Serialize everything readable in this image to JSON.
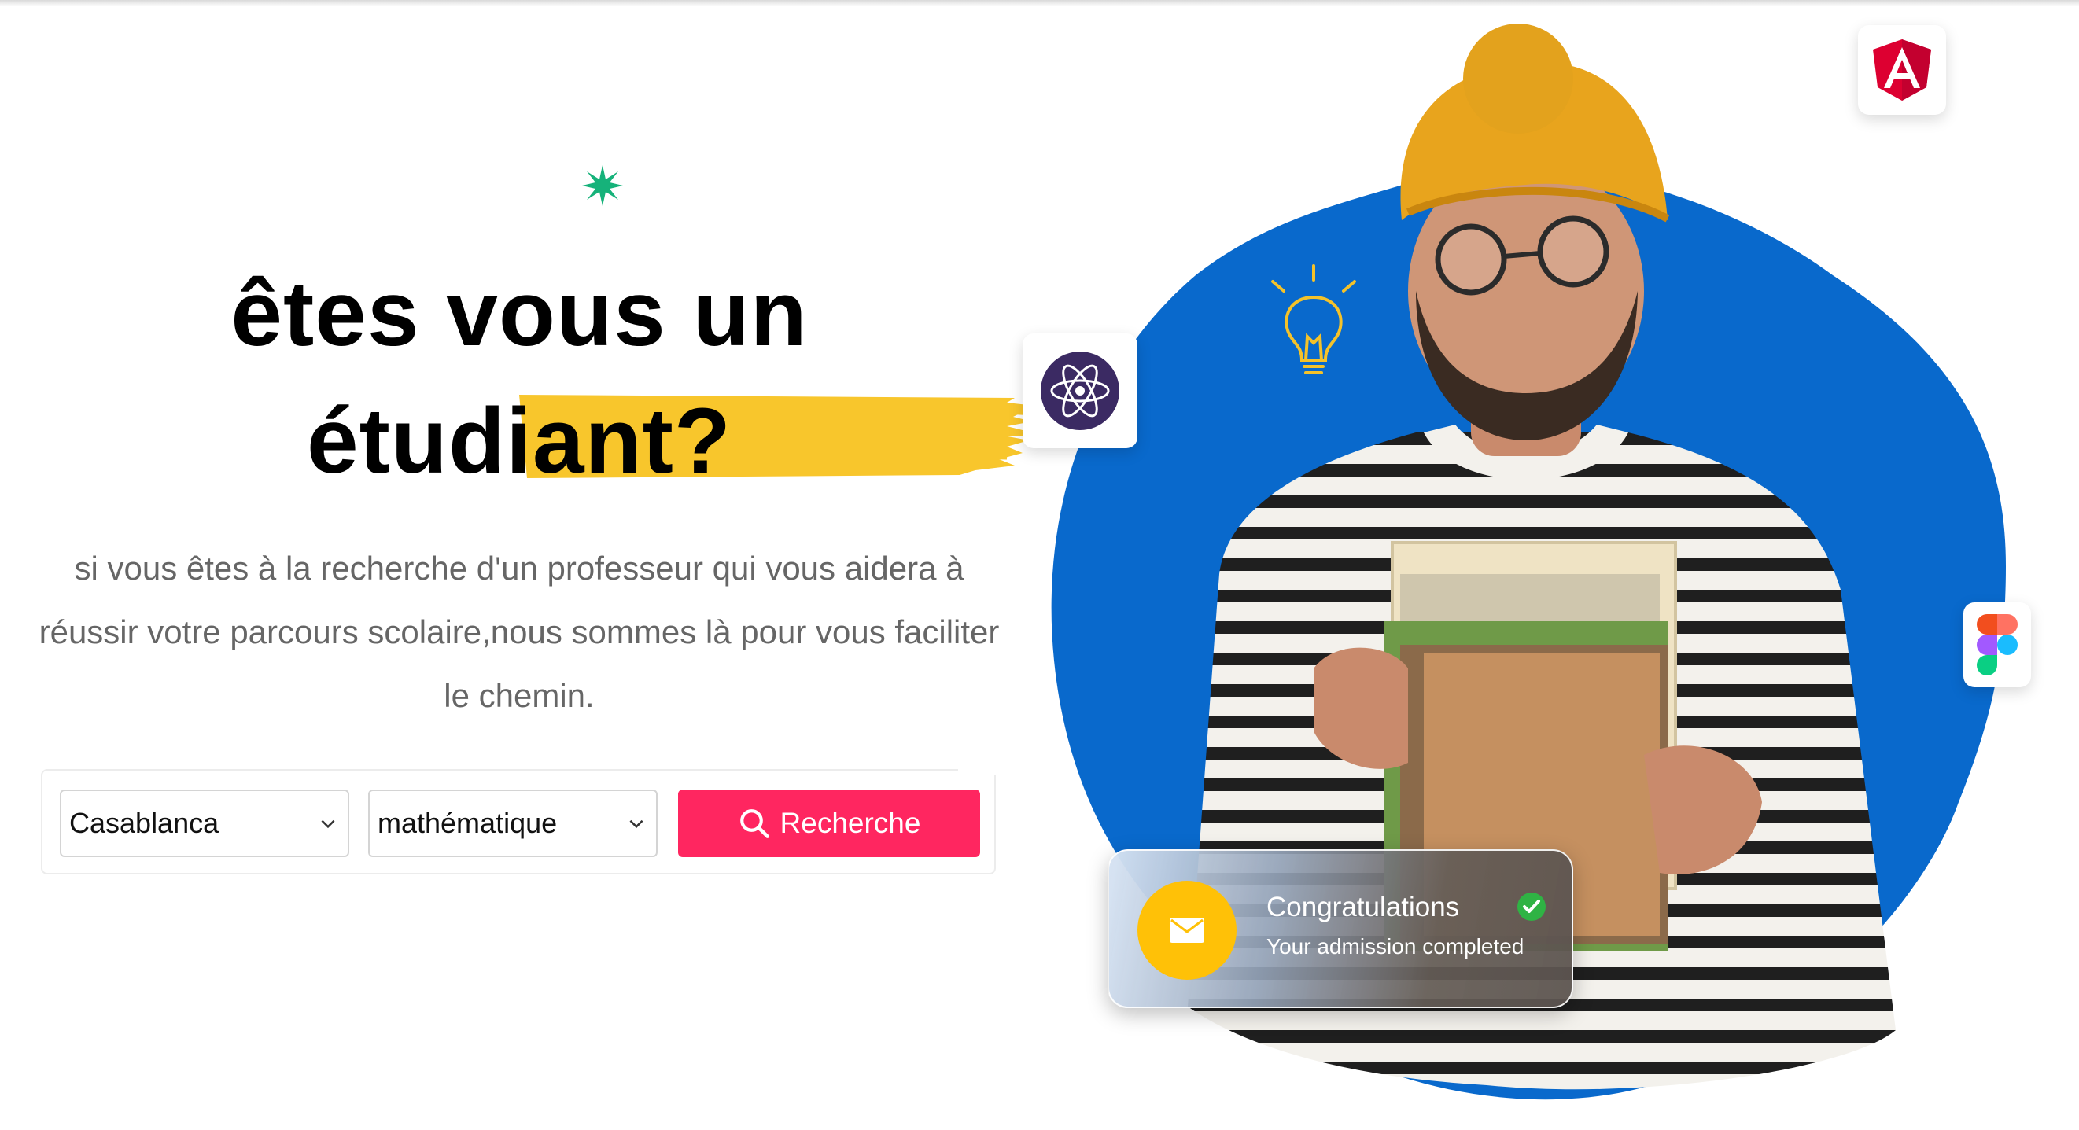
{
  "hero": {
    "title_line1": "êtes vous un",
    "title_line2_plain": "étud",
    "title_line2_highlight": "iant?",
    "subtitle": "si vous êtes à la recherche d'un professeur qui vous aidera à réussir votre parcours scolaire,nous sommes là pour vous faciliter le chemin."
  },
  "search": {
    "city_selected": "Casablanca",
    "subject_selected": "mathématique",
    "button_label": "Recherche",
    "button_icon": "search-icon"
  },
  "congrats_card": {
    "title": "Congratulations",
    "subtitle": "Your admission completed",
    "icon": "mail-icon",
    "status_icon": "check-circle-icon"
  },
  "badges": [
    "angular-logo",
    "react-atom-logo",
    "figma-logo",
    "lightbulb-icon"
  ],
  "colors": {
    "accent": "#ff2660",
    "highlight_brush": "#f8c62c",
    "blob_blue": "#0969cc",
    "sparkle_green": "#16b27a",
    "mail_circle": "#ffc107",
    "check_green": "#2fb344",
    "angular_red": "#dd0031",
    "react_purple": "#3b2a63"
  }
}
